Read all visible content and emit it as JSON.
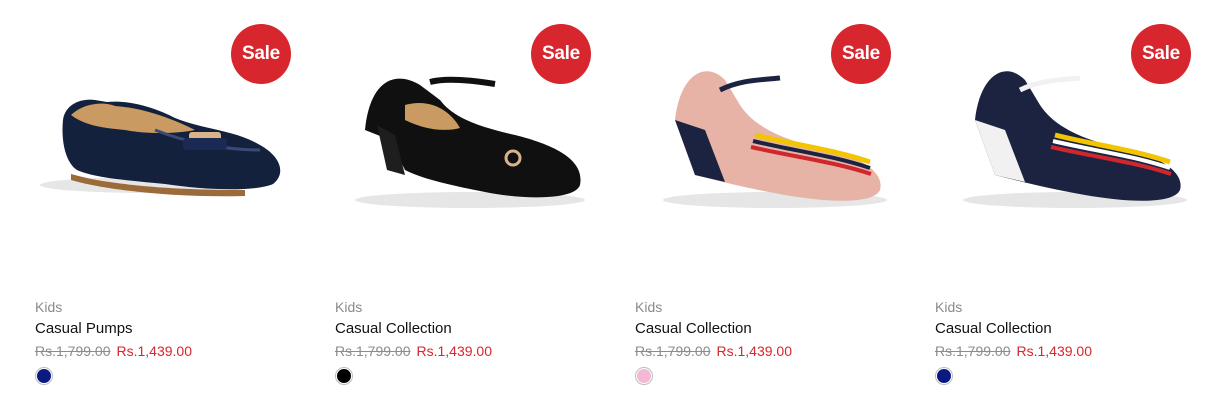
{
  "products": [
    {
      "badge": "Sale",
      "category": "Kids",
      "title": "Casual Pumps",
      "old_price": "Rs.1,799.00",
      "price": "Rs.1,439.00",
      "swatch_color": "#0b1a80"
    },
    {
      "badge": "Sale",
      "category": "Kids",
      "title": "Casual Collection",
      "old_price": "Rs.1,799.00",
      "price": "Rs.1,439.00",
      "swatch_color": "#000000"
    },
    {
      "badge": "Sale",
      "category": "Kids",
      "title": "Casual Collection",
      "old_price": "Rs.1,799.00",
      "price": "Rs.1,439.00",
      "swatch_color": "#f4b7d4"
    },
    {
      "badge": "Sale",
      "category": "Kids",
      "title": "Casual Collection",
      "old_price": "Rs.1,799.00",
      "price": "Rs.1,439.00",
      "swatch_color": "#0b1a80"
    }
  ],
  "colors": {
    "sale": "#d7262d",
    "price": "#d7262d",
    "old_price": "#8c8c8c"
  }
}
